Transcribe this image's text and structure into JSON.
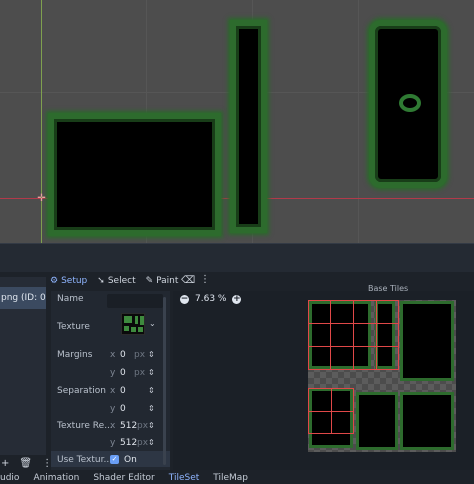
{
  "toolbar": {
    "setup_label": "Setup",
    "select_label": "Select",
    "paint_label": "Paint"
  },
  "sources": {
    "selected_item": "png (ID: 0)"
  },
  "inspector": {
    "name_label": "Name",
    "texture_label": "Texture",
    "margins_label": "Margins",
    "margin_x": "0",
    "margin_y": "0",
    "separation_label": "Separation",
    "separation_x": "0",
    "separation_y": "0",
    "texture_region_label": "Texture Re...",
    "region_x": "512",
    "region_y": "512",
    "use_texture_label": "Use Textur...",
    "use_texture_value": "On",
    "x_axis": "x",
    "y_axis": "y",
    "unit_px": "px"
  },
  "atlas": {
    "zoom_level": "7.63 %",
    "base_tiles_label": "Base Tiles"
  },
  "bottom_tabs": [
    "udio",
    "Animation",
    "Shader Editor",
    "TileSet",
    "TileMap"
  ],
  "active_tab": "TileSet",
  "colors": {
    "accent": "#8fb5ff",
    "grass": "#2d6b2d",
    "grid_red": "#e04848"
  },
  "icons": {
    "setup": "wrench-icon",
    "select": "pointer-icon",
    "paint": "brush-icon",
    "erase": "eraser-icon",
    "more": "kebab-menu-icon",
    "zoom_out": "zoom-out-icon",
    "zoom_in": "zoom-in-icon",
    "add": "plus-icon",
    "remove": "trash-icon",
    "options": "more-icon"
  }
}
